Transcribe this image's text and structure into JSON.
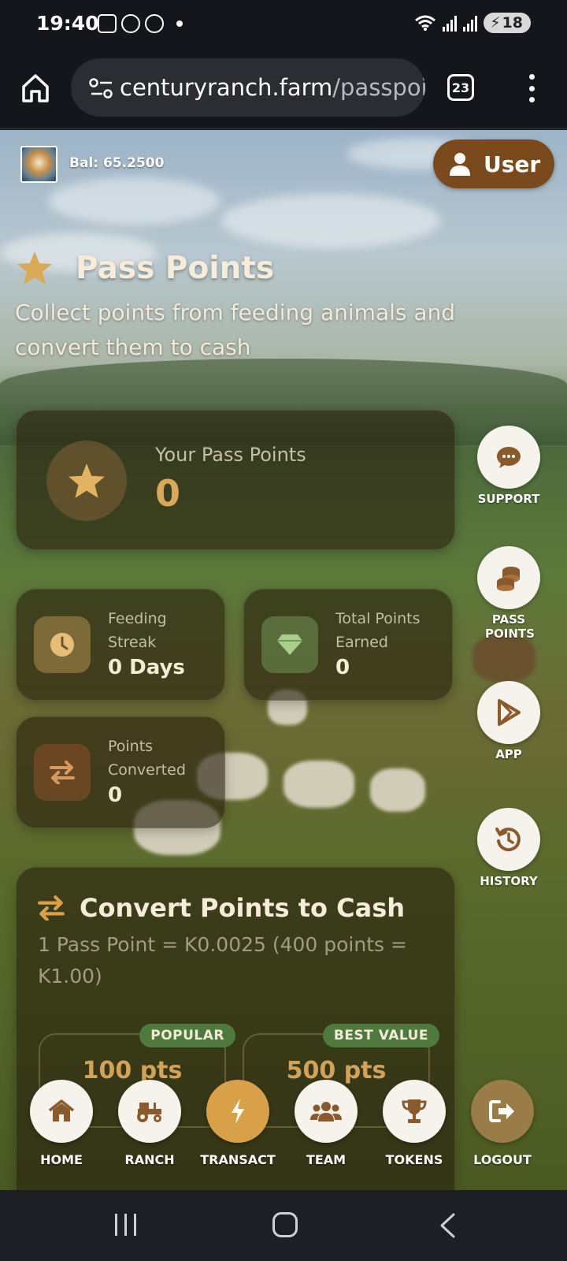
{
  "status_bar": {
    "time": "19:40",
    "battery": "18"
  },
  "browser": {
    "url_domain": "centuryranch.farm",
    "url_path": "/passpoir",
    "tab_count": "23"
  },
  "header": {
    "balance": "Bal: 65.2500",
    "user_label": "User"
  },
  "page": {
    "title": "Pass Points",
    "subtitle": "Collect points from feeding animals and convert them to cash"
  },
  "points_card": {
    "label": "Your Pass Points",
    "value": "0"
  },
  "stats": {
    "streak_label": "Feeding Streak",
    "streak_value": "0 Days",
    "total_label": "Total Points Earned",
    "total_value": "0",
    "converted_label": "Points Converted",
    "converted_value": "0"
  },
  "convert": {
    "title": "Convert Points to Cash",
    "rate": "1 Pass Point = K0.0025 (400 points = K1.00)",
    "options": [
      {
        "badge": "POPULAR",
        "points": "100 pts"
      },
      {
        "badge": "BEST VALUE",
        "points": "500 pts"
      }
    ]
  },
  "side_menu": {
    "support": "SUPPORT",
    "pass_points": "PASS POINTS",
    "app": "APP",
    "history": "HISTORY"
  },
  "bottom_nav": [
    {
      "label": "HOME",
      "icon": "home-icon"
    },
    {
      "label": "RANCH",
      "icon": "tractor-icon"
    },
    {
      "label": "TRANSACT",
      "icon": "bolt-icon"
    },
    {
      "label": "TEAM",
      "icon": "users-icon"
    },
    {
      "label": "TOKENS",
      "icon": "trophy-icon"
    },
    {
      "label": "LOGOUT",
      "icon": "logout-icon"
    }
  ],
  "colors": {
    "accent": "#d9a04a",
    "brown": "#7a4a1c",
    "badge_green": "#4f7a3e",
    "gold_text": "#d8a95a"
  }
}
